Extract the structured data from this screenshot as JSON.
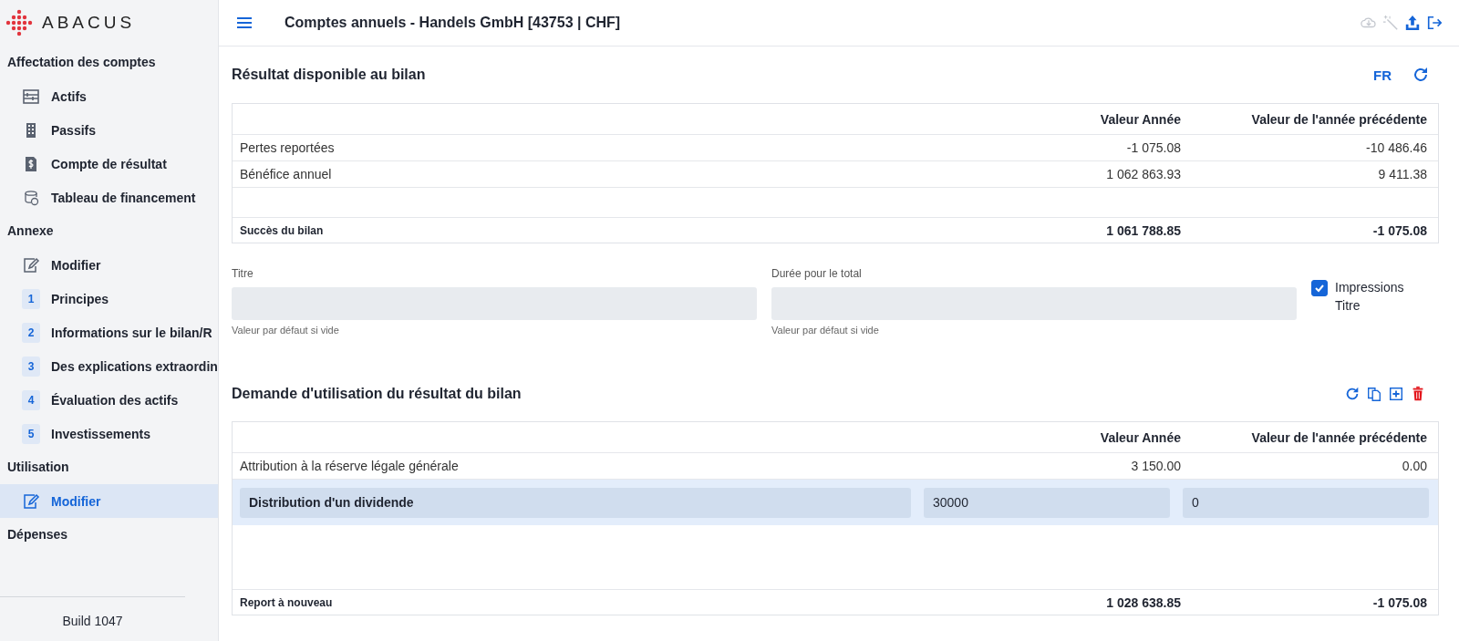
{
  "brand": "ABACUS",
  "sidebar": [
    {
      "heading": "Affectation des comptes",
      "items": [
        {
          "label": "Actifs",
          "kind": "abacus",
          "selected": false
        },
        {
          "label": "Passifs",
          "kind": "building",
          "selected": false
        },
        {
          "label": "Compte de résultat",
          "kind": "document",
          "selected": false
        },
        {
          "label": "Tableau de financement",
          "kind": "coins",
          "selected": false
        }
      ]
    },
    {
      "heading": "Annexe",
      "items": [
        {
          "label": "Modifier",
          "kind": "edit",
          "selected": false
        },
        {
          "label": "Principes",
          "kind": "number",
          "badge": "1",
          "selected": false
        },
        {
          "label": "Informations sur le bilan/R",
          "kind": "number",
          "badge": "2",
          "selected": false
        },
        {
          "label": "Des explications extraordin",
          "kind": "number",
          "badge": "3",
          "selected": false
        },
        {
          "label": "Évaluation des actifs",
          "kind": "number",
          "badge": "4",
          "selected": false
        },
        {
          "label": "Investissements",
          "kind": "number",
          "badge": "5",
          "selected": false
        }
      ]
    },
    {
      "heading": "Utilisation",
      "items": [
        {
          "label": "Modifier",
          "kind": "edit",
          "selected": true
        }
      ]
    },
    {
      "heading": "Dépenses"
    }
  ],
  "build": "Build 1047",
  "header": {
    "title": "Comptes annuels - Handels GmbH [43753 | CHF]",
    "actions": [
      {
        "kind": "download",
        "disabled": true
      },
      {
        "kind": "wand",
        "disabled": true
      },
      {
        "kind": "upload",
        "disabled": false
      },
      {
        "kind": "logout",
        "disabled": false
      }
    ]
  },
  "section1": {
    "title": "Résultat disponible au bilan",
    "language": "FR",
    "table": {
      "columns": [
        "Valeur Année",
        "Valeur de l'année précédente"
      ],
      "rows": [
        {
          "kind": "row",
          "label": "Pertes reportées",
          "values": [
            "-1 075.08",
            "-10 486.46"
          ]
        },
        {
          "kind": "row",
          "label": "Bénéfice annuel",
          "values": [
            "1 062 863.93",
            "9 411.38"
          ]
        },
        {
          "kind": "total",
          "label": "Succès du bilan",
          "values": [
            "1 061 788.85",
            "-1 075.08"
          ]
        }
      ]
    }
  },
  "form": {
    "fields": [
      {
        "label": "Titre",
        "hint": "Valeur par défaut si vide"
      },
      {
        "label": "Durée pour le total",
        "hint": "Valeur par défaut si vide"
      }
    ],
    "checkbox": {
      "label": "Impressions Titre",
      "checked": true
    }
  },
  "section2": {
    "title": "Demande d'utilisation du résultat du bilan",
    "table": {
      "columns": [
        "Valeur Année",
        "Valeur de l'année précédente"
      ],
      "rows": [
        {
          "kind": "row",
          "label": "Attribution à la réserve légale générale",
          "values": [
            "3 150.00",
            "0.00"
          ]
        },
        {
          "kind": "edit",
          "label": "Distribution d'un dividende",
          "values": [
            "30000",
            "0"
          ]
        },
        {
          "kind": "total",
          "label": "Report à nouveau",
          "values": [
            "1 028 638.85",
            "-1 075.08"
          ]
        }
      ]
    }
  }
}
